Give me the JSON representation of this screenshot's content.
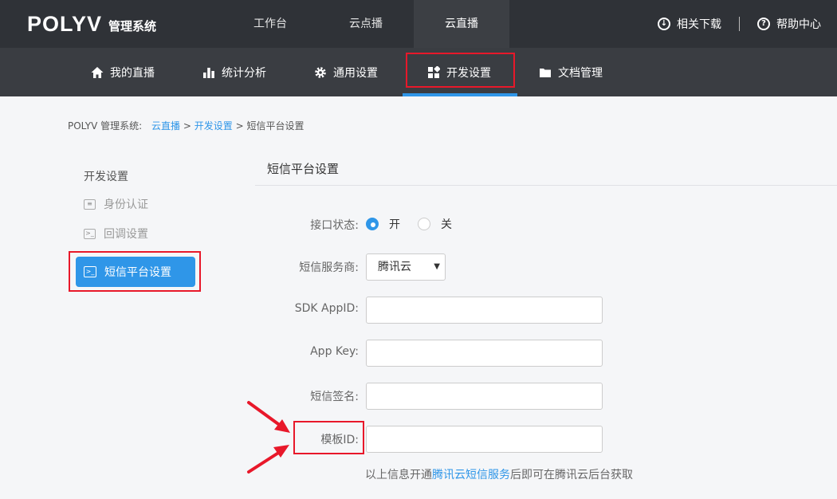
{
  "header": {
    "logo": "POLYV",
    "logo_sub": "管理系统",
    "nav": [
      {
        "label": "工作台",
        "active": false
      },
      {
        "label": "云点播",
        "active": false
      },
      {
        "label": "云直播",
        "active": true
      }
    ],
    "download": "相关下载",
    "help": "帮助中心"
  },
  "subnav": {
    "items": [
      {
        "label": "我的直播",
        "icon": "home-icon"
      },
      {
        "label": "统计分析",
        "icon": "bar-chart-icon"
      },
      {
        "label": "通用设置",
        "icon": "gear-icon"
      },
      {
        "label": "开发设置",
        "icon": "grid-icon",
        "active": true
      },
      {
        "label": "文档管理",
        "icon": "folder-icon"
      }
    ]
  },
  "breadcrumb": {
    "prefix": "POLYV 管理系统:",
    "crumb1": "云直播",
    "sep": ">",
    "crumb2": "开发设置",
    "current": "短信平台设置"
  },
  "sidebar": {
    "title": "开发设置",
    "items": [
      {
        "label": "身份认证",
        "icon": "id-card-icon"
      },
      {
        "label": "回调设置",
        "icon": "terminal-icon"
      },
      {
        "label": "短信平台设置",
        "icon": "terminal-icon",
        "active": true
      }
    ]
  },
  "content": {
    "title": "短信平台设置",
    "status_label": "接口状态:",
    "status_on": "开",
    "status_off": "关",
    "provider_label": "短信服务商:",
    "provider_value": "腾讯云",
    "appid_label": "SDK AppID:",
    "appkey_label": "App Key:",
    "sign_label": "短信签名:",
    "template_label": "模板ID:",
    "hint_pre": "以上信息开通",
    "hint_link": "腾讯云短信服务",
    "hint_post": "后即可在腾讯云后台获取"
  },
  "colors": {
    "accent": "#2f96e8",
    "highlight": "#e8182a",
    "topbar": "#2f3237"
  }
}
